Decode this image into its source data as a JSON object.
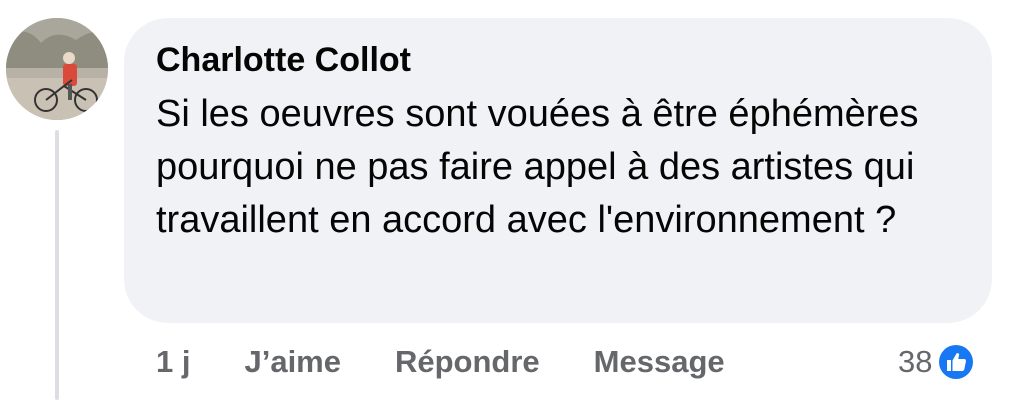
{
  "comment": {
    "author": "Charlotte Collot",
    "text": "Si les oeuvres sont vouées à être éphémères pourquoi ne pas faire appel à des artistes qui travaillent en accord avec l'environnement ?",
    "avatar_icon": "profile-photo-person-with-bicycle"
  },
  "actions": {
    "time": "1 j",
    "like_label": "J’aime",
    "reply_label": "Répondre",
    "message_label": "Message"
  },
  "reactions": {
    "count": "38",
    "icon": "like-thumbs-up-icon",
    "icon_color": "#1877f2"
  },
  "colors": {
    "bubble": "#f0f2f5",
    "text": "#050505",
    "secondary_text": "#65676b"
  }
}
